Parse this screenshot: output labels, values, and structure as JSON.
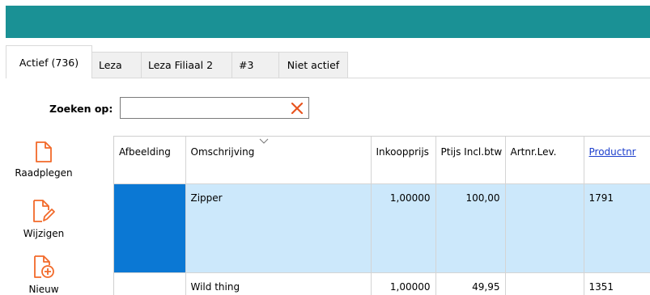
{
  "colors": {
    "topbar": "#1a9195",
    "selected_row": "#cce8fb",
    "image_cell": "#0b78d4",
    "action_icon": "#f26a2a",
    "link": "#1a3dcc"
  },
  "tabs": [
    {
      "label": "Actief (736)",
      "active": true
    },
    {
      "label": "Leza",
      "active": false
    },
    {
      "label": "Leza Filiaal 2",
      "active": false
    },
    {
      "label": "#3",
      "active": false
    },
    {
      "label": "Niet actief",
      "active": false
    }
  ],
  "search": {
    "label": "Zoeken op:",
    "value": "",
    "clear_icon": "close-x-icon"
  },
  "actions": [
    {
      "label": "Raadplegen",
      "icon": "document-icon"
    },
    {
      "label": "Wijzigen",
      "icon": "edit-document-icon"
    },
    {
      "label": "Nieuw",
      "icon": "new-document-icon"
    }
  ],
  "table": {
    "columns": [
      "Afbeelding",
      "Omschrijving",
      "Inkoopprijs",
      "Ptijs Incl.btw",
      "Artnr.Lev.",
      "Productnr"
    ],
    "rows": [
      {
        "afbeelding": "",
        "omschrijving": "Zipper",
        "inkoopprijs": "1,00000",
        "prijs": "100,00",
        "artnr": "",
        "productnr": "1791",
        "selected": true
      },
      {
        "afbeelding": "",
        "omschrijving": "Wild thing",
        "inkoopprijs": "1,00000",
        "prijs": "49,95",
        "artnr": "",
        "productnr": "1351",
        "selected": false
      }
    ]
  }
}
